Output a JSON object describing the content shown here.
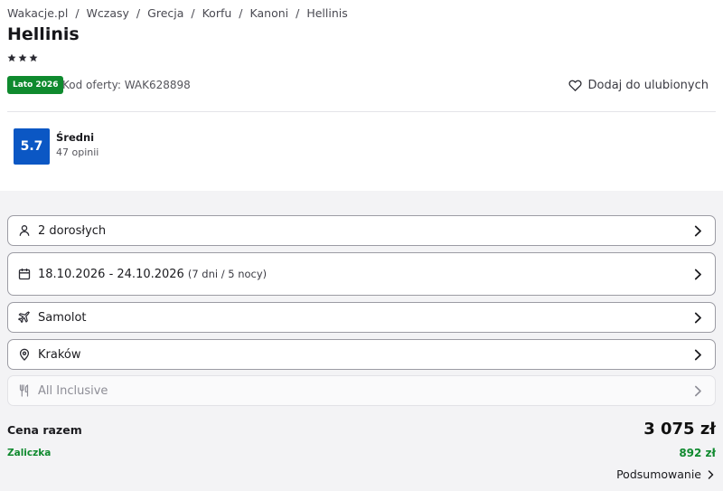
{
  "breadcrumb": [
    "Wakacje.pl",
    "Wczasy",
    "Grecja",
    "Korfu",
    "Kanoni",
    "Hellinis"
  ],
  "breadcrumb_separator": "/",
  "hotel": {
    "name": "Hellinis",
    "stars": 3
  },
  "offer": {
    "season_badge": "Lato 2026",
    "code": "Kod oferty: WAK628898",
    "favorite_label": "Dodaj do ulubionych"
  },
  "rating": {
    "score": "5.7",
    "label": "Średni",
    "count": "47 opinii"
  },
  "options": {
    "travelers": "2 dorosłych",
    "dates": "18.10.2026 - 24.10.2026",
    "duration": "(7 dni / 5 nocy)",
    "transport": "Samolot",
    "departure": "Kraków",
    "board": "All Inclusive"
  },
  "price": {
    "total_label": "Cena razem",
    "total_value": "3 075 zł",
    "deposit_label": "Zaliczka",
    "deposit_value": "892 zł",
    "summary_link": "Podsumowanie"
  },
  "colors": {
    "badge": "#0f8a2e",
    "rating": "#0b57c4",
    "deposit": "#108a2f",
    "section_bg": "#f3f3f5"
  },
  "icons": {
    "travelers": "person-icon",
    "dates": "calendar-icon",
    "transport": "plane-icon",
    "departure": "location-pin-icon",
    "board": "fork-knife-icon",
    "favorite": "heart-icon"
  }
}
